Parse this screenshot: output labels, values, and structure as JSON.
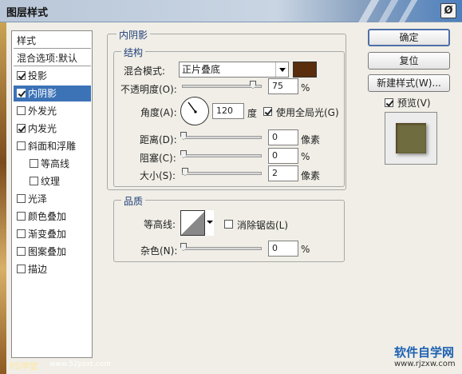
{
  "window": {
    "title": "图层样式",
    "close_glyph": "Ø"
  },
  "styles_list": {
    "header": "样式",
    "blend_options": "混合选项:默认",
    "items": [
      {
        "label": "投影",
        "checked": true,
        "selected": false
      },
      {
        "label": "内阴影",
        "checked": true,
        "selected": true
      },
      {
        "label": "外发光",
        "checked": false,
        "selected": false
      },
      {
        "label": "内发光",
        "checked": true,
        "selected": false
      },
      {
        "label": "斜面和浮雕",
        "checked": false,
        "selected": false
      },
      {
        "label": "等高线",
        "checked": false,
        "selected": false,
        "sub": true
      },
      {
        "label": "纹理",
        "checked": false,
        "selected": false,
        "sub": true
      },
      {
        "label": "光泽",
        "checked": false,
        "selected": false
      },
      {
        "label": "颜色叠加",
        "checked": false,
        "selected": false
      },
      {
        "label": "渐变叠加",
        "checked": false,
        "selected": false
      },
      {
        "label": "图案叠加",
        "checked": false,
        "selected": false
      },
      {
        "label": "描边",
        "checked": false,
        "selected": false
      }
    ]
  },
  "inner_shadow": {
    "section_title": "内阴影",
    "structure": {
      "title": "结构",
      "blend_mode_label": "混合模式:",
      "blend_mode_value": "正片叠底",
      "color": "#5a2d0c",
      "opacity_label": "不透明度(O):",
      "opacity_value": "75",
      "opacity_unit": "%",
      "angle_label": "角度(A):",
      "angle_value": "120",
      "angle_unit": "度",
      "global_light_label": "使用全局光(G)",
      "global_light_checked": true,
      "distance_label": "距离(D):",
      "distance_value": "0",
      "distance_unit": "像素",
      "choke_label": "阻塞(C):",
      "choke_value": "0",
      "choke_unit": "%",
      "size_label": "大小(S):",
      "size_value": "2",
      "size_unit": "像素"
    },
    "quality": {
      "title": "品质",
      "contour_label": "等高线:",
      "antialias_label": "消除锯齿(L)",
      "antialias_checked": false,
      "noise_label": "杂色(N):",
      "noise_value": "0",
      "noise_unit": "%"
    }
  },
  "buttons": {
    "ok": "确定",
    "cancel": "复位",
    "new_style": "新建样式(W)...",
    "preview_label": "预览(V)",
    "preview_checked": true
  },
  "preview": {
    "swatch_color": "#6f6d3f"
  },
  "watermarks": {
    "left": "PS学堂",
    "left_url": "www.52psxt.com",
    "right_brand": "软件自学网",
    "right_url": "www.rjzxw.com"
  }
}
